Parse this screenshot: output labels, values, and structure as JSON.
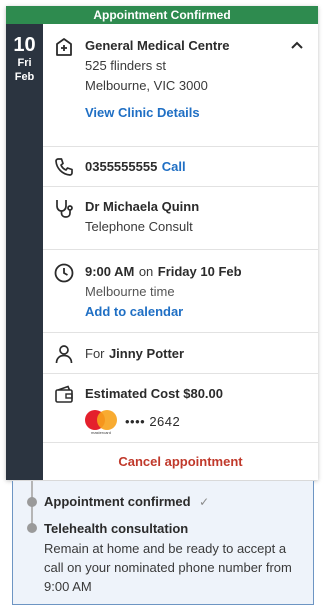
{
  "banner": "Appointment Confirmed",
  "date": {
    "day": "10",
    "weekday": "Fri",
    "month": "Feb"
  },
  "clinic": {
    "name": "General Medical Centre",
    "address_line1": "525 flinders st",
    "address_line2": "Melbourne, VIC 3000",
    "details_link": "View Clinic Details"
  },
  "phone": {
    "number": "0355555555",
    "call_label": "Call"
  },
  "doctor": {
    "name": "Dr Michaela Quinn",
    "consult_type": "Telephone Consult"
  },
  "time": {
    "time": "9:00 AM",
    "on": "on",
    "date": "Friday 10 Feb",
    "timezone": "Melbourne time",
    "calendar_link": "Add to calendar"
  },
  "patient": {
    "prefix": "For",
    "name": "Jinny Potter"
  },
  "cost": {
    "label": "Estimated Cost $80.00",
    "card_brand": "mastercard",
    "card_masked": "•••• 2642"
  },
  "cancel_label": "Cancel appointment",
  "timeline": {
    "items": [
      {
        "title": "Appointment confirmed",
        "status": "✓"
      },
      {
        "title": "Telehealth consultation",
        "description": "Remain at home and be ready to accept a call on your nominated phone number from 9:00 AM"
      }
    ]
  },
  "colors": {
    "banner": "#2e8b4f",
    "date_column": "#2b3440",
    "link": "#1f6fc4",
    "cancel": "#c0392b"
  }
}
